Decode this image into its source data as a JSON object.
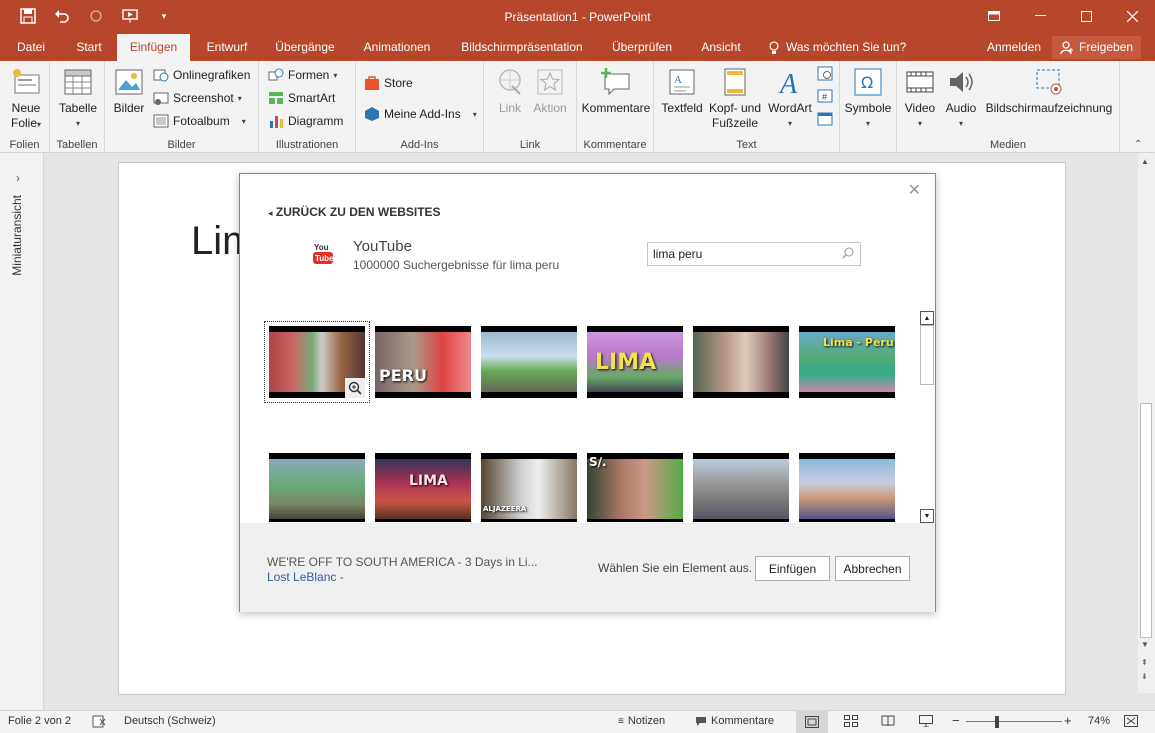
{
  "titlebar": {
    "title": "Präsentation1 - PowerPoint",
    "accent": "#b7472a"
  },
  "tabs": [
    {
      "label": "Datei"
    },
    {
      "label": "Start"
    },
    {
      "label": "Einfügen",
      "active": true
    },
    {
      "label": "Entwurf"
    },
    {
      "label": "Übergänge"
    },
    {
      "label": "Animationen"
    },
    {
      "label": "Bildschirmpräsentation"
    },
    {
      "label": "Überprüfen"
    },
    {
      "label": "Ansicht"
    }
  ],
  "tellme": "Was möchten Sie tun?",
  "account": {
    "signin": "Anmelden",
    "share": "Freigeben"
  },
  "ribbon": {
    "folien": {
      "new_slide_1": "Neue",
      "new_slide_2": "Folie",
      "label": "Folien"
    },
    "tabellen": {
      "table": "Tabelle",
      "label": "Tabellen"
    },
    "bilder": {
      "pictures": "Bilder",
      "online": "Onlinegrafiken",
      "screenshot": "Screenshot",
      "album": "Fotoalbum",
      "label": "Bilder"
    },
    "illustrationen": {
      "shapes": "Formen",
      "smartart": "SmartArt",
      "chart": "Diagramm",
      "label": "Illustrationen"
    },
    "addins": {
      "store": "Store",
      "my_addins": "Meine Add-Ins",
      "label": "Add-Ins"
    },
    "link": {
      "link": "Link",
      "action": "Aktion",
      "label": "Link"
    },
    "kommentare": {
      "comment": "Kommentare",
      "label": "Kommentare"
    },
    "text": {
      "textbox": "Textfeld",
      "header_1": "Kopf- und",
      "header_2": "Fußzeile",
      "wordart": "WordArt",
      "label": "Text"
    },
    "symbole": {
      "symbols": "Symbole"
    },
    "medien": {
      "video": "Video",
      "audio": "Audio",
      "screen_rec": "Bildschirmaufzeichnung",
      "label": "Medien"
    }
  },
  "leftpane": {
    "label": "Miniaturansicht"
  },
  "slide": {
    "title_visible": "Lim"
  },
  "dialog": {
    "back": "ZURÜCK ZU DEN WEBSITES",
    "provider": "YouTube",
    "results_text": "1000000 Suchergebnisse für lima peru",
    "search_value": "lima peru",
    "thumbnails": [
      {
        "text": ""
      },
      {
        "text": "PERU"
      },
      {
        "text": ""
      },
      {
        "text": "LIMA"
      },
      {
        "text": ""
      },
      {
        "text": "Lima - Peru"
      },
      {
        "text": ""
      },
      {
        "text": "LIMA"
      },
      {
        "text": "ALJAZEERA"
      },
      {
        "text": "S/."
      },
      {
        "text": ""
      },
      {
        "text": ""
      }
    ],
    "selected_title": "WE'RE OFF TO SOUTH AMERICA - 3 Days in Li...",
    "selected_author": "Lost LeBlanc -",
    "hint": "Wählen Sie ein Element aus.",
    "insert": "Einfügen",
    "cancel": "Abbrechen"
  },
  "statusbar": {
    "slide": "Folie 2 von 2",
    "language": "Deutsch (Schweiz)",
    "notes": "Notizen",
    "comments": "Kommentare",
    "zoom": "74%"
  }
}
